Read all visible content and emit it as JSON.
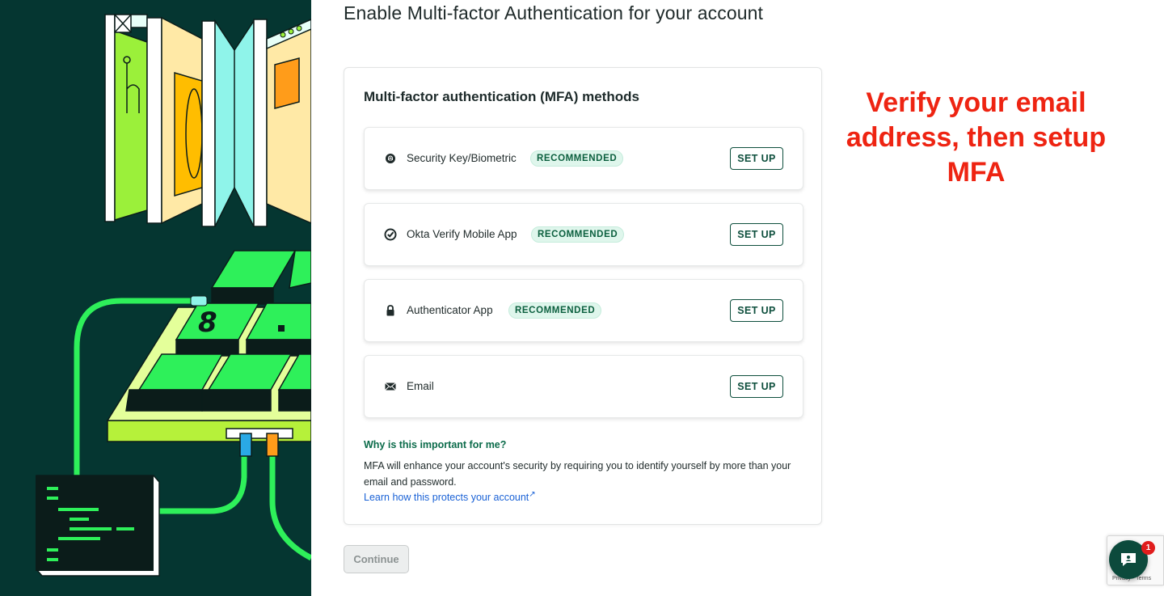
{
  "page": {
    "title": "Enable Multi-factor Authentication for your account"
  },
  "card": {
    "title": "Multi-factor authentication (MFA) methods",
    "methods": [
      {
        "label": "Security Key/Biometric",
        "badge": "RECOMMENDED",
        "action": "SET UP",
        "icon": "fingerprint-icon"
      },
      {
        "label": "Okta Verify Mobile App",
        "badge": "RECOMMENDED",
        "action": "SET UP",
        "icon": "okta-verify-icon"
      },
      {
        "label": "Authenticator App",
        "badge": "RECOMMENDED",
        "action": "SET UP",
        "icon": "lock-icon"
      },
      {
        "label": "Email",
        "badge": "",
        "action": "SET UP",
        "icon": "envelope-icon"
      }
    ],
    "why": {
      "title": "Why is this important for me?",
      "text": "MFA will enhance your account's security by requiring you to identify yourself by more than your email and password.",
      "link": "Learn how this protects your account"
    }
  },
  "continue_label": "Continue",
  "annotation": "Verify your email address, then setup MFA",
  "chat": {
    "badge_count": "1",
    "icon": "chat-icon"
  },
  "recaptcha": {
    "privacy": "Privacy",
    "terms": "Terms"
  },
  "colors": {
    "illustration_bg": "#053631",
    "accent_green": "#0e4f3d",
    "badge_bg": "#dff6ec",
    "annotation_red": "#ee2412",
    "link_blue": "#1a62d6"
  }
}
